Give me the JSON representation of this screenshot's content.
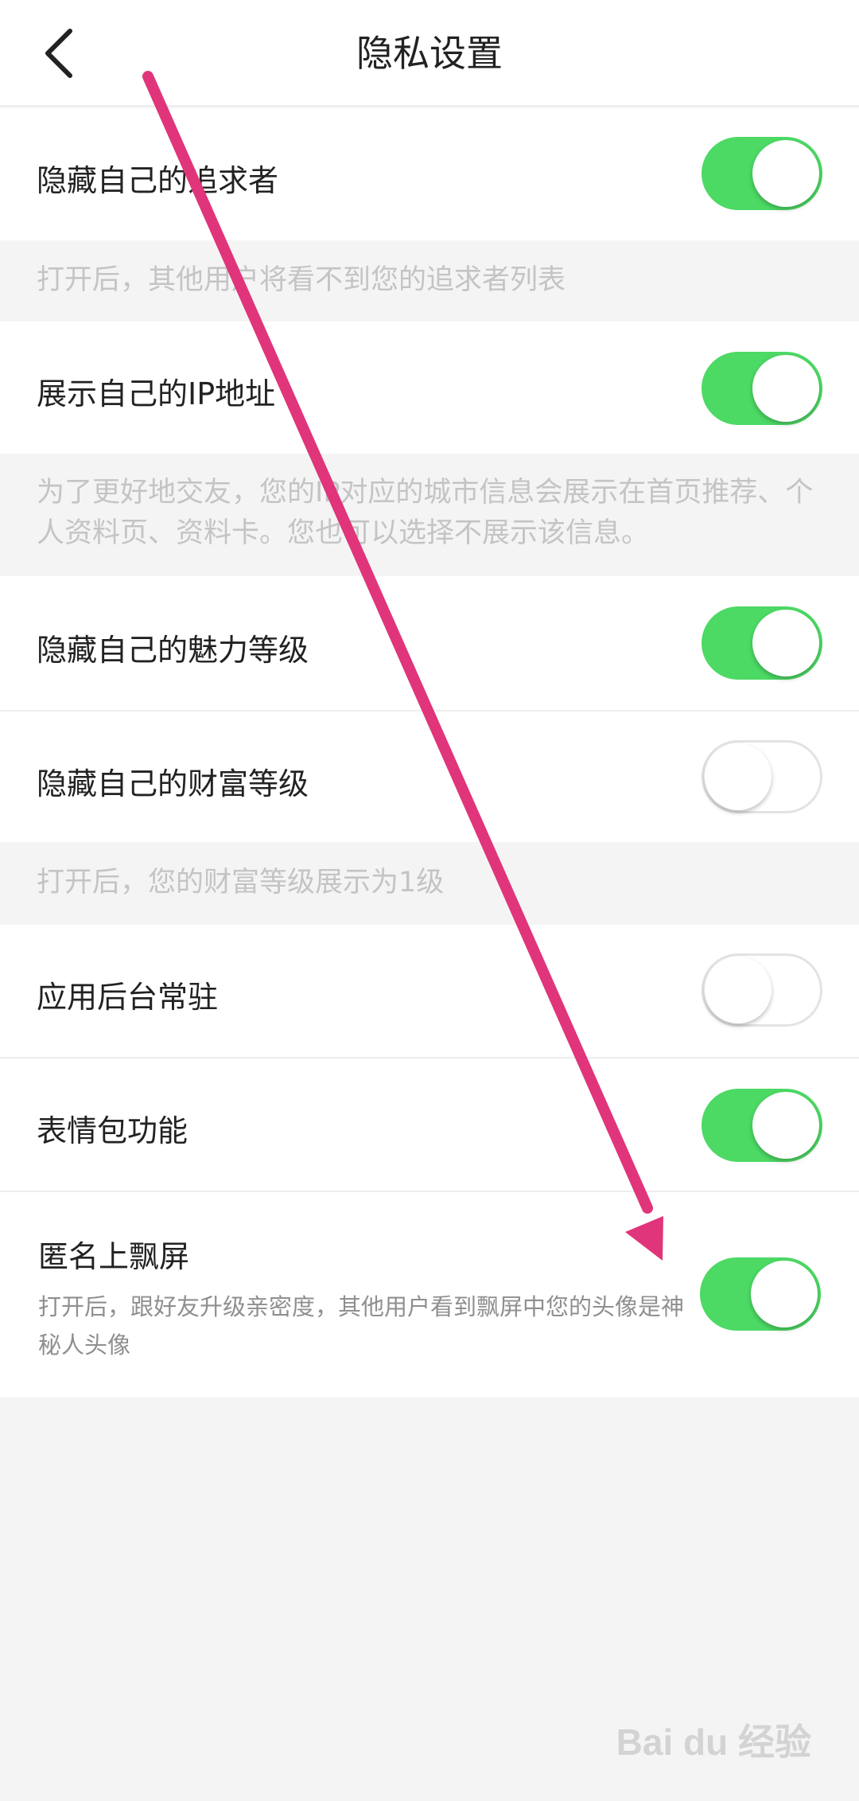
{
  "header": {
    "title": "隐私设置"
  },
  "settings": {
    "hide_followers": {
      "label": "隐藏自己的追求者",
      "enabled": true
    },
    "hide_followers_hint": "打开后，其他用户将看不到您的追求者列表",
    "show_ip": {
      "label": "展示自己的IP地址",
      "enabled": true
    },
    "show_ip_hint": "为了更好地交友，您的IP对应的城市信息会展示在首页推荐、个人资料页、资料卡。您也可以选择不展示该信息。",
    "hide_charm": {
      "label": "隐藏自己的魅力等级",
      "enabled": true
    },
    "hide_wealth": {
      "label": "隐藏自己的财富等级",
      "enabled": false
    },
    "hide_wealth_hint": "打开后，您的财富等级展示为1级",
    "background_resident": {
      "label": "应用后台常驻",
      "enabled": false
    },
    "sticker_feature": {
      "label": "表情包功能",
      "enabled": true
    },
    "anonymous_float": {
      "label": "匿名上飘屏",
      "description": "打开后，跟好友升级亲密度，其他用户看到飘屏中您的头像是神秘人头像",
      "enabled": true
    }
  },
  "watermark": "Bai du 经验",
  "colors": {
    "toggle_on": "#4cd964",
    "arrow": "#e0357a"
  }
}
